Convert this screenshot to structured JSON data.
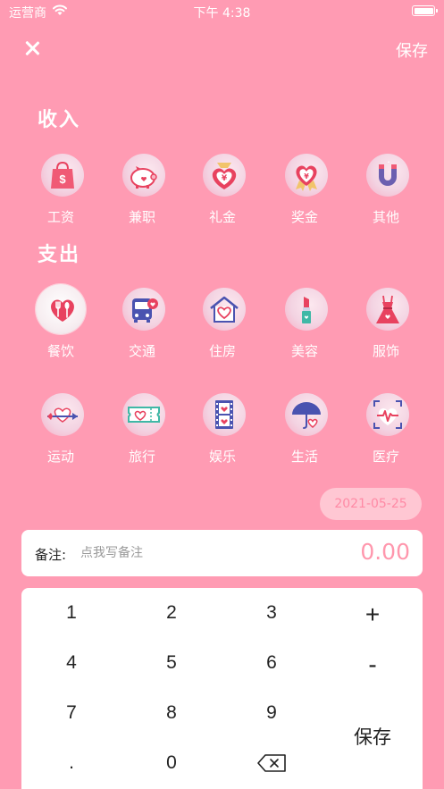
{
  "status_bar": {
    "carrier": "运营商",
    "time": "下午 4:38"
  },
  "header": {
    "save_label": "保存"
  },
  "income": {
    "title": "收入",
    "items": [
      {
        "label": "工资",
        "icon": "shopping-bag-icon"
      },
      {
        "label": "兼职",
        "icon": "piggy-bank-icon"
      },
      {
        "label": "礼金",
        "icon": "money-bag-icon"
      },
      {
        "label": "奖金",
        "icon": "heart-award-icon"
      },
      {
        "label": "其他",
        "icon": "magnet-icon"
      }
    ]
  },
  "expense": {
    "title": "支出",
    "selected": "餐饮",
    "items": [
      {
        "label": "餐饮",
        "icon": "cutlery-heart-icon"
      },
      {
        "label": "交通",
        "icon": "bus-icon"
      },
      {
        "label": "住房",
        "icon": "house-icon"
      },
      {
        "label": "美容",
        "icon": "lipstick-icon"
      },
      {
        "label": "服饰",
        "icon": "dress-icon"
      },
      {
        "label": "运动",
        "icon": "arrow-heart-icon"
      },
      {
        "label": "旅行",
        "icon": "ticket-icon"
      },
      {
        "label": "娱乐",
        "icon": "film-icon"
      },
      {
        "label": "生活",
        "icon": "umbrella-icon"
      },
      {
        "label": "医疗",
        "icon": "heartbeat-icon"
      }
    ]
  },
  "date": "2021-05-25",
  "note": {
    "label": "备注:",
    "placeholder": "点我写备注",
    "amount": "0.00"
  },
  "keypad": {
    "keys": [
      "1",
      "2",
      "3",
      "4",
      "5",
      "6",
      "7",
      "8",
      "9",
      ".",
      "0"
    ],
    "plus": "+",
    "minus": "-",
    "save": "保存"
  },
  "colors": {
    "background": "#ff9bb3",
    "accent": "#ff97ad",
    "date_pill": "#ffc7d3",
    "icon_red": "#e8425f"
  }
}
